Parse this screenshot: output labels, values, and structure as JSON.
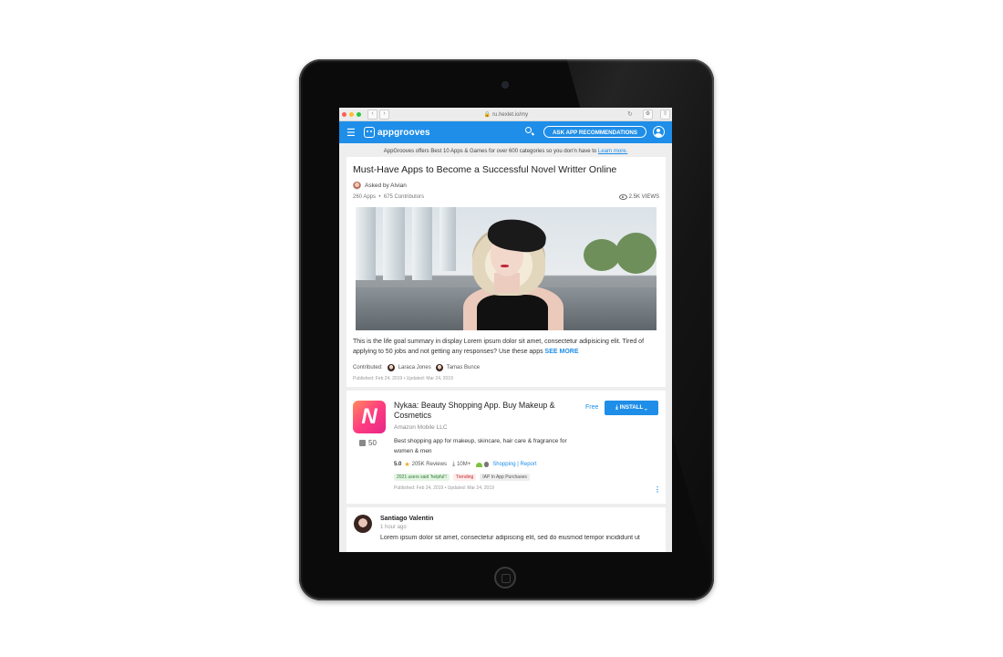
{
  "browser": {
    "url": "ru.hexlet.io/my"
  },
  "header": {
    "logo_text": "appgrooves",
    "ask_button": "ASK APP RECOMMENDATIONS",
    "accent_color": "#1e8ee8"
  },
  "info_bar": {
    "text": "AppGrooves offers Best 10 Apps & Games for over 600 categories so you don'n have to ",
    "link": "Learn more."
  },
  "question": {
    "title": "Must-Have Apps to Become a Successful Novel Writter Online",
    "asked_by": "Asked by Alvian",
    "apps_count": "260 Apps",
    "contributors": "675 Contributors",
    "views": "2.5K VIEWS",
    "summary": "This is the life goal summary in display Lorem ipsum dolor sit amet, consectetur adipisicing elit. Tired of applying to 50 jobs and not getting any responses? Use these apps ",
    "see_more": "SEE MORE",
    "contributed_label": "Contributed:",
    "contributor_1": "Laraca Jones",
    "contributor_2": "Tamas Bunce",
    "published": "Published: Feb 24, 2019  •  Updated: Mar 24, 2019"
  },
  "app_card": {
    "icon_letter": "N",
    "likes": "50",
    "title": "Nykaa: Beauty Shopping App. Buy Makeup & Cosmetics",
    "developer": "Amazon Mobile LLC",
    "description": "Best shopping app for makeup, skincare, hair care & fragrance for women & men",
    "price": "Free",
    "install": "INSTALL",
    "rating": "5.0",
    "reviews": "205K Reviews",
    "downloads": "10M+",
    "category": "Shopping | Report",
    "tag_helpful": "2021 users said 'helpful'!",
    "tag_trending": "Trending",
    "tag_iap": "IAP  In App Purchases",
    "published": "Published: Feb 24, 2019  •  Updated: Mar 24, 2019"
  },
  "comment": {
    "name": "Santiago Valentin",
    "time": "1 hour ago",
    "text": "Lorem ipsum dolor sit amet, consectetur adipiscing elit, sed do eiusmod tempor incididunt ut"
  }
}
